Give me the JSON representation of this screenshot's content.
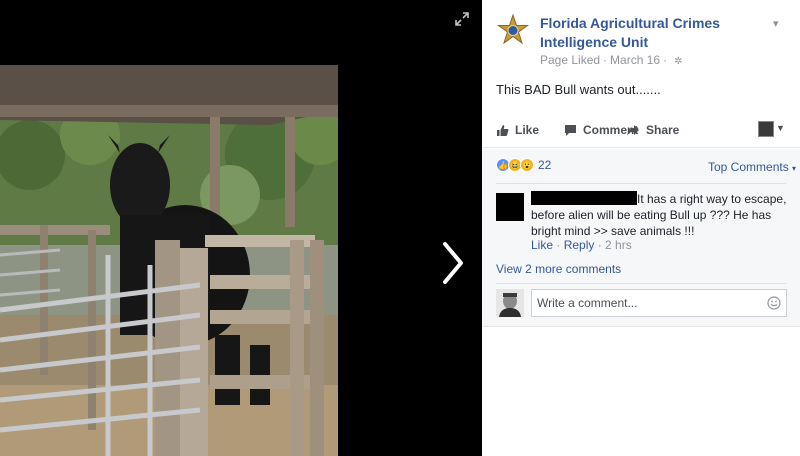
{
  "post": {
    "page_name": "Florida Agricultural Crimes Intelligence Unit",
    "meta": {
      "status": "Page Liked",
      "date": "March 16"
    },
    "text": "This BAD Bull wants out.......",
    "badge_icon": "sheriff-star-badge"
  },
  "actions": {
    "like": "Like",
    "comment": "Comment",
    "share": "Share"
  },
  "reactions": {
    "types": [
      "like",
      "haha",
      "wow"
    ],
    "count": "22"
  },
  "comments_header": {
    "sort_label": "Top Comments"
  },
  "comments": [
    {
      "author": "",
      "text": "It has a right way to escape, before alien will be eating Bull up ??? He has bright mind >> save animals !!!",
      "like_label": "Like",
      "reply_label": "Reply",
      "time": "2 hrs"
    }
  ],
  "view_more": "View 2 more comments",
  "composer": {
    "placeholder": "Write a comment..."
  },
  "colors": {
    "link": "#365899",
    "meta": "#90949c",
    "panel_bg": "#ffffff",
    "comments_bg": "#f6f7f9",
    "viewer_bg": "#000000"
  }
}
